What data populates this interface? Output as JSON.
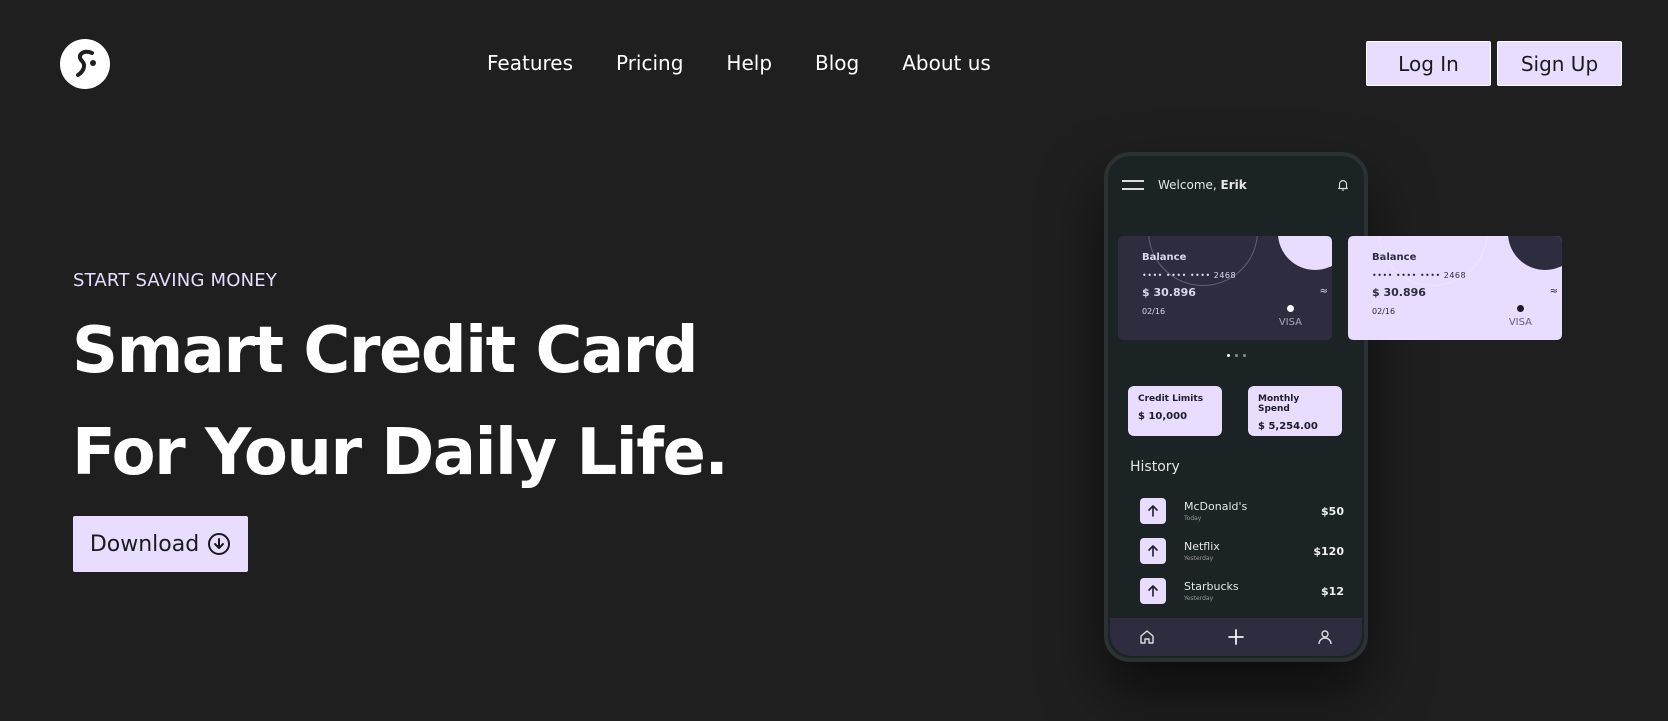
{
  "nav": {
    "items": [
      "Features",
      "Pricing",
      "Help",
      "Blog",
      "About us"
    ]
  },
  "auth": {
    "login_label": "Log In",
    "signup_label": "Sign Up"
  },
  "hero": {
    "eyebrow": "START SAVING MONEY",
    "headline_line1": "Smart Credit Card",
    "headline_line2": "For Your Daily Life.",
    "download_label": "Download"
  },
  "phone": {
    "welcome_prefix": "Welcome,",
    "user_name": "Erik",
    "cards": [
      {
        "title": "Balance",
        "number": "•••• •••• •••• 2468",
        "amount": "$ 30.896",
        "expiry": "02/16",
        "brand": "VISA"
      },
      {
        "title": "Balance",
        "number": "•••• •••• •••• 2468",
        "amount": "$ 30.896",
        "expiry": "02/16",
        "brand": "VISA"
      }
    ],
    "stats": [
      {
        "label": "Credit Limits",
        "value": "$ 10,000"
      },
      {
        "label": "Monthly Spend",
        "value": "$ 5,254.00"
      }
    ],
    "history_title": "History",
    "transactions": [
      {
        "name": "McDonald's",
        "when": "Today",
        "amount": "$50"
      },
      {
        "name": "Netflix",
        "when": "Yesterday",
        "amount": "$120"
      },
      {
        "name": "Starbucks",
        "when": "Yesterday",
        "amount": "$12"
      }
    ]
  },
  "icons": {
    "logo": "brand-s-icon",
    "download": "arrow-down-circle-icon",
    "menu": "hamburger-icon",
    "bell": "bell-icon",
    "tx": "arrow-up-icon",
    "tabs": [
      "home-icon",
      "plus-icon",
      "user-icon"
    ]
  },
  "colors": {
    "background": "#1f1f1f",
    "accent": "#e8dcff",
    "card_dark": "#2e2d40",
    "phone_bg": "#1b2324"
  }
}
